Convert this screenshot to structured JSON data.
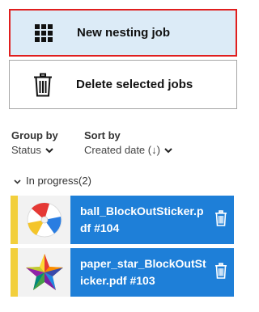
{
  "actions": {
    "new_job_label": "New nesting job",
    "delete_label": "Delete selected jobs"
  },
  "filters": {
    "group_by": {
      "title": "Group by",
      "value": "Status"
    },
    "sort_by": {
      "title": "Sort by",
      "value": "Created date (↓)"
    }
  },
  "section": {
    "label": "In progress(2)"
  },
  "jobs": [
    {
      "title": "ball_BlockOutSticker.pdf #104",
      "thumbnail": "beach-ball",
      "status_color": "#f2cf3c"
    },
    {
      "title": "paper_star_BlockOutSticker.pdf #103",
      "thumbnail": "paper-star",
      "status_color": "#f2cf3c"
    }
  ],
  "colors": {
    "accent": "#1e7fd8",
    "selected_bg": "#dcebf7",
    "highlight_border": "#e01e1e",
    "status_in_progress": "#f2cf3c"
  }
}
